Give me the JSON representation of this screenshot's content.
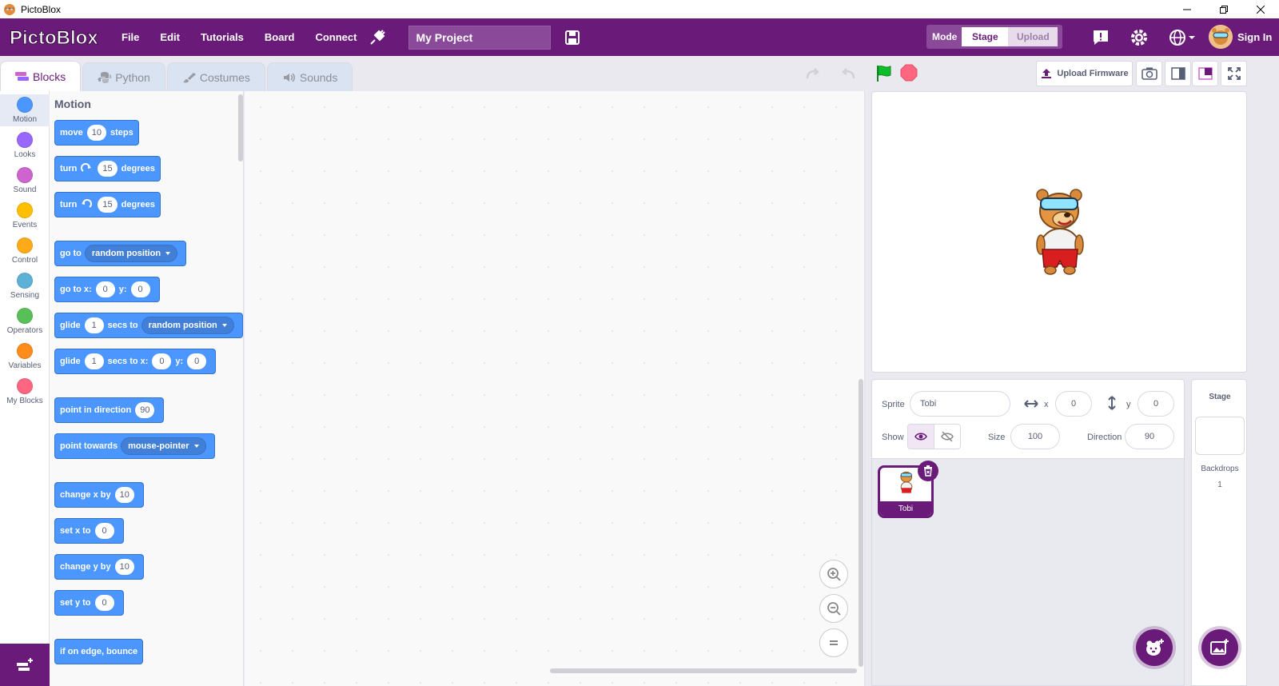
{
  "window": {
    "title": "PictoBlox"
  },
  "menu": {
    "logo_text": "PictoBlox",
    "items": [
      "File",
      "Edit",
      "Tutorials",
      "Board",
      "Connect"
    ],
    "project_name": "My Project",
    "mode_label": "Mode",
    "mode_options": [
      "Stage",
      "Upload"
    ],
    "signin": "Sign In"
  },
  "tabs": [
    "Blocks",
    "Python",
    "Costumes",
    "Sounds"
  ],
  "toolbar": {
    "upload_firmware": "Upload Firmware"
  },
  "categories": [
    {
      "name": "Motion",
      "color": "#4c97ff"
    },
    {
      "name": "Looks",
      "color": "#9966ff"
    },
    {
      "name": "Sound",
      "color": "#cf63cf"
    },
    {
      "name": "Events",
      "color": "#ffbf00"
    },
    {
      "name": "Control",
      "color": "#ffab19"
    },
    {
      "name": "Sensing",
      "color": "#5cb1d6"
    },
    {
      "name": "Operators",
      "color": "#59c059"
    },
    {
      "name": "Variables",
      "color": "#ff8c1a"
    },
    {
      "name": "My Blocks",
      "color": "#ff6680"
    }
  ],
  "palette": {
    "title": "Motion",
    "blocks": {
      "move": {
        "a": "move",
        "v": "10",
        "b": "steps"
      },
      "turn_cw": {
        "a": "turn",
        "v": "15",
        "b": "degrees"
      },
      "turn_ccw": {
        "a": "turn",
        "v": "15",
        "b": "degrees"
      },
      "goto": {
        "a": "go to",
        "dd": "random position"
      },
      "gotoxy": {
        "a": "go to x:",
        "x": "0",
        "b": "y:",
        "y": "0"
      },
      "glide": {
        "a": "glide",
        "v": "1",
        "b": "secs to",
        "dd": "random position"
      },
      "glidexy": {
        "a": "glide",
        "v": "1",
        "b": "secs to x:",
        "x": "0",
        "c": "y:",
        "y": "0"
      },
      "point": {
        "a": "point in direction",
        "v": "90"
      },
      "towards": {
        "a": "point towards",
        "dd": "mouse-pointer"
      },
      "changex": {
        "a": "change x by",
        "v": "10"
      },
      "setx": {
        "a": "set x to",
        "v": "0"
      },
      "changey": {
        "a": "change y by",
        "v": "10"
      },
      "sety": {
        "a": "set y to",
        "v": "0"
      },
      "bounce": {
        "a": "if on edge, bounce"
      }
    }
  },
  "sprite": {
    "label": "Sprite",
    "name": "Tobi",
    "x_label": "x",
    "x": "0",
    "y_label": "y",
    "y": "0",
    "show_label": "Show",
    "size_label": "Size",
    "size": "100",
    "direction_label": "Direction",
    "direction": "90"
  },
  "sprites": [
    {
      "name": "Tobi"
    }
  ],
  "stage_panel": {
    "title": "Stage",
    "backdrops_label": "Backdrops",
    "backdrops_count": "1"
  },
  "colors": {
    "brand": "#6a1b7a",
    "motion": "#4c97ff",
    "green_flag": "#0fbd2c",
    "stop": "#ff6680"
  }
}
